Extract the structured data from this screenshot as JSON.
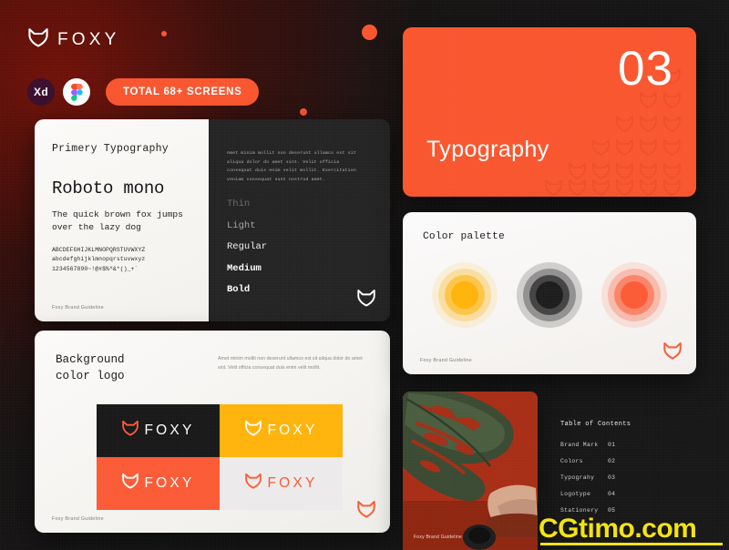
{
  "brand": {
    "logo_icon": "fox-head-icon",
    "wordmark": "FOXY",
    "badges": [
      {
        "id": "xd",
        "label": "Xd",
        "icon": "adobe-xd-icon",
        "bg": "#3b0f2e"
      },
      {
        "id": "figma",
        "label": "",
        "icon": "figma-icon",
        "bg": "#ffffff"
      }
    ],
    "pill_label": "TOTAL 68+ SCREENS",
    "pill_color": "#f9562f"
  },
  "decor": {
    "dots": [
      {
        "name": "orange-dot-small-left",
        "color": "#f9562f"
      },
      {
        "name": "orange-dot-large",
        "color": "#f9562f"
      },
      {
        "name": "orange-dot-small-center",
        "color": "#f9562f"
      }
    ]
  },
  "typography_card": {
    "title": "Primery Typography",
    "font_name": "Roboto mono",
    "pangram": "The quick brown fox jumps over the lazy dog",
    "glyphs_upper": "ABCDEFGHIJKLMNOPQRSTUVWXYZ",
    "glyphs_lower": "abcdefghijklmnopqrstuvwxyz",
    "glyphs_numeric": "1234567890~!@#$%^&*()_+`",
    "footer": "Foxy Brand Guideline",
    "lorem": "Amet minim mollit non deserunt ullamco est sit aliqua dolor do amet sint. Velit officia consequat duis enim velit mollit. Exercitation veniam consequat sunt nostrud amet.",
    "weights": [
      {
        "label": "Thin",
        "class": "w-thin"
      },
      {
        "label": "Light",
        "class": "w-light"
      },
      {
        "label": "Regular",
        "class": "w-regular"
      },
      {
        "label": "Medium",
        "class": "w-medium"
      },
      {
        "label": "Bold",
        "class": "w-bold"
      }
    ],
    "mark_icon": "fox-head-icon"
  },
  "background_logo_card": {
    "title": "Background\ncolor logo",
    "lorem": "Amet minim mollit non deserunt ullamco est sit aliqua dolor do amet sint. Velit officia consequat duis enim velit mollit.",
    "footer": "Foxy Brand Guideline",
    "mark_icon": "fox-head-icon",
    "cells": [
      {
        "name": "logo-on-dark",
        "bg": "#191919",
        "word": "FOXY",
        "word_color": "#ffffff",
        "mark_color": "#fb5b36"
      },
      {
        "name": "logo-on-amber",
        "bg": "#ffb30b",
        "word": "FOXY",
        "word_color": "#ffffff",
        "mark_color": "#ffffff"
      },
      {
        "name": "logo-on-coral",
        "bg": "#fb5b36",
        "word": "FOXY",
        "word_color": "#ffffff",
        "mark_color": "#ffffff"
      },
      {
        "name": "logo-on-light",
        "bg": "#eceaea",
        "word": "FOXY",
        "word_color": "#fb5b36",
        "mark_color": "#fb5b36"
      }
    ]
  },
  "hero": {
    "number": "03",
    "title": "Typography",
    "bg_color": "#f9562f",
    "pattern_icon": "fox-head-pattern"
  },
  "palette_card": {
    "title": "Color palette",
    "footer": "Foxy Brand Guideline",
    "mark_icon": "fox-head-icon",
    "swatches": [
      {
        "name": "swatch-amber",
        "core": "#ffb30b",
        "rings": [
          "rgba(255,179,11,0.12)",
          "rgba(255,179,11,0.28)",
          "rgba(255,179,11,0.58)",
          "#ffb30b"
        ]
      },
      {
        "name": "swatch-charcoal",
        "core": "#1d1d1d",
        "rings": [
          "rgba(29,29,29,0.18)",
          "rgba(29,29,29,0.34)",
          "rgba(29,29,29,0.66)",
          "#1d1d1d"
        ]
      },
      {
        "name": "swatch-coral",
        "core": "#fb5b36",
        "rings": [
          "rgba(251,91,54,0.13)",
          "rgba(251,91,54,0.28)",
          "rgba(251,91,54,0.56)",
          "#fb5b36"
        ]
      }
    ]
  },
  "photo_card": {
    "footer": "Foxy Brand Guideline",
    "subject": "monstera-leaf-photo"
  },
  "toc": {
    "title": "Table of Contents",
    "rows": [
      {
        "label": "Brand Mark",
        "num": "01"
      },
      {
        "label": "Colors",
        "num": "02"
      },
      {
        "label": "Typograhy",
        "num": "03"
      },
      {
        "label": "Logotype",
        "num": "04"
      },
      {
        "label": "Stationery",
        "num": "05"
      }
    ]
  },
  "watermark": {
    "text": "CGtimo.com",
    "color": "#f2e313"
  }
}
